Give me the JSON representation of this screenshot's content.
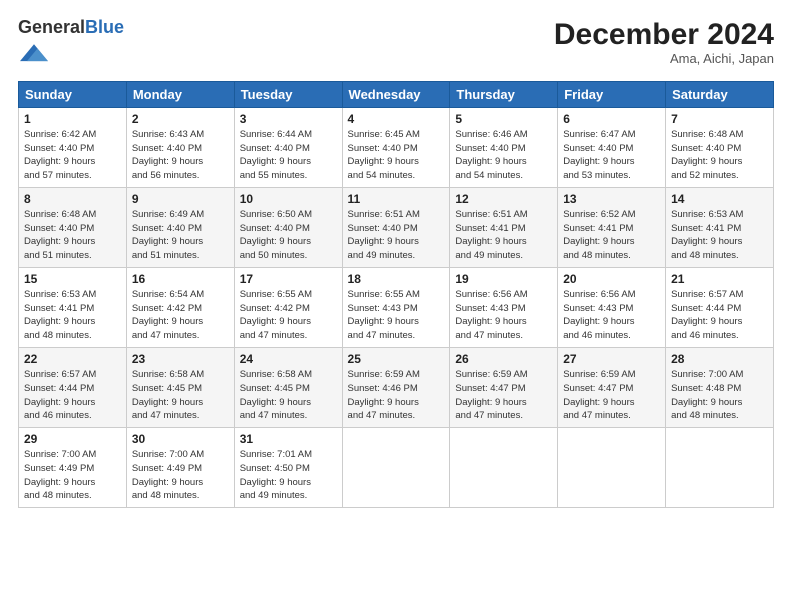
{
  "header": {
    "logo_general": "General",
    "logo_blue": "Blue",
    "month_title": "December 2024",
    "location": "Ama, Aichi, Japan"
  },
  "weekdays": [
    "Sunday",
    "Monday",
    "Tuesday",
    "Wednesday",
    "Thursday",
    "Friday",
    "Saturday"
  ],
  "weeks": [
    [
      {
        "day": "1",
        "sunrise": "6:42 AM",
        "sunset": "4:40 PM",
        "daylight": "9 hours and 57 minutes."
      },
      {
        "day": "2",
        "sunrise": "6:43 AM",
        "sunset": "4:40 PM",
        "daylight": "9 hours and 56 minutes."
      },
      {
        "day": "3",
        "sunrise": "6:44 AM",
        "sunset": "4:40 PM",
        "daylight": "9 hours and 55 minutes."
      },
      {
        "day": "4",
        "sunrise": "6:45 AM",
        "sunset": "4:40 PM",
        "daylight": "9 hours and 54 minutes."
      },
      {
        "day": "5",
        "sunrise": "6:46 AM",
        "sunset": "4:40 PM",
        "daylight": "9 hours and 54 minutes."
      },
      {
        "day": "6",
        "sunrise": "6:47 AM",
        "sunset": "4:40 PM",
        "daylight": "9 hours and 53 minutes."
      },
      {
        "day": "7",
        "sunrise": "6:48 AM",
        "sunset": "4:40 PM",
        "daylight": "9 hours and 52 minutes."
      }
    ],
    [
      {
        "day": "8",
        "sunrise": "6:48 AM",
        "sunset": "4:40 PM",
        "daylight": "9 hours and 51 minutes."
      },
      {
        "day": "9",
        "sunrise": "6:49 AM",
        "sunset": "4:40 PM",
        "daylight": "9 hours and 51 minutes."
      },
      {
        "day": "10",
        "sunrise": "6:50 AM",
        "sunset": "4:40 PM",
        "daylight": "9 hours and 50 minutes."
      },
      {
        "day": "11",
        "sunrise": "6:51 AM",
        "sunset": "4:40 PM",
        "daylight": "9 hours and 49 minutes."
      },
      {
        "day": "12",
        "sunrise": "6:51 AM",
        "sunset": "4:41 PM",
        "daylight": "9 hours and 49 minutes."
      },
      {
        "day": "13",
        "sunrise": "6:52 AM",
        "sunset": "4:41 PM",
        "daylight": "9 hours and 48 minutes."
      },
      {
        "day": "14",
        "sunrise": "6:53 AM",
        "sunset": "4:41 PM",
        "daylight": "9 hours and 48 minutes."
      }
    ],
    [
      {
        "day": "15",
        "sunrise": "6:53 AM",
        "sunset": "4:41 PM",
        "daylight": "9 hours and 48 minutes."
      },
      {
        "day": "16",
        "sunrise": "6:54 AM",
        "sunset": "4:42 PM",
        "daylight": "9 hours and 47 minutes."
      },
      {
        "day": "17",
        "sunrise": "6:55 AM",
        "sunset": "4:42 PM",
        "daylight": "9 hours and 47 minutes."
      },
      {
        "day": "18",
        "sunrise": "6:55 AM",
        "sunset": "4:43 PM",
        "daylight": "9 hours and 47 minutes."
      },
      {
        "day": "19",
        "sunrise": "6:56 AM",
        "sunset": "4:43 PM",
        "daylight": "9 hours and 47 minutes."
      },
      {
        "day": "20",
        "sunrise": "6:56 AM",
        "sunset": "4:43 PM",
        "daylight": "9 hours and 46 minutes."
      },
      {
        "day": "21",
        "sunrise": "6:57 AM",
        "sunset": "4:44 PM",
        "daylight": "9 hours and 46 minutes."
      }
    ],
    [
      {
        "day": "22",
        "sunrise": "6:57 AM",
        "sunset": "4:44 PM",
        "daylight": "9 hours and 46 minutes."
      },
      {
        "day": "23",
        "sunrise": "6:58 AM",
        "sunset": "4:45 PM",
        "daylight": "9 hours and 47 minutes."
      },
      {
        "day": "24",
        "sunrise": "6:58 AM",
        "sunset": "4:45 PM",
        "daylight": "9 hours and 47 minutes."
      },
      {
        "day": "25",
        "sunrise": "6:59 AM",
        "sunset": "4:46 PM",
        "daylight": "9 hours and 47 minutes."
      },
      {
        "day": "26",
        "sunrise": "6:59 AM",
        "sunset": "4:47 PM",
        "daylight": "9 hours and 47 minutes."
      },
      {
        "day": "27",
        "sunrise": "6:59 AM",
        "sunset": "4:47 PM",
        "daylight": "9 hours and 47 minutes."
      },
      {
        "day": "28",
        "sunrise": "7:00 AM",
        "sunset": "4:48 PM",
        "daylight": "9 hours and 48 minutes."
      }
    ],
    [
      {
        "day": "29",
        "sunrise": "7:00 AM",
        "sunset": "4:49 PM",
        "daylight": "9 hours and 48 minutes."
      },
      {
        "day": "30",
        "sunrise": "7:00 AM",
        "sunset": "4:49 PM",
        "daylight": "9 hours and 48 minutes."
      },
      {
        "day": "31",
        "sunrise": "7:01 AM",
        "sunset": "4:50 PM",
        "daylight": "9 hours and 49 minutes."
      },
      null,
      null,
      null,
      null
    ]
  ],
  "labels": {
    "sunrise": "Sunrise:",
    "sunset": "Sunset:",
    "daylight": "Daylight:"
  }
}
